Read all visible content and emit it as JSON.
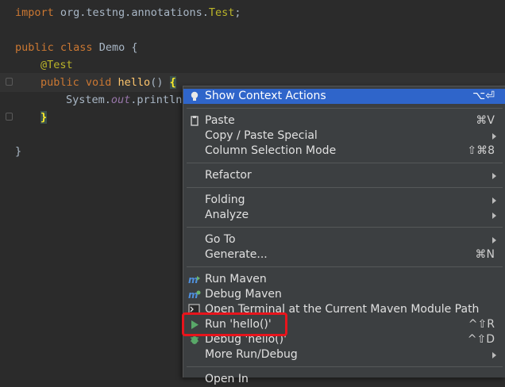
{
  "editor": {
    "lines": {
      "l1": {
        "kw": "import",
        "pkg": " org.testng.annotations.",
        "ann": "Test",
        "end": ";"
      },
      "l3": {
        "kw1": "public",
        "kw2": " class",
        "name": " Demo {"
      },
      "l4": {
        "ann": "@Test"
      },
      "l5": {
        "kw1": "public",
        "kw2": " void",
        "fn": " hello",
        "params": "() ",
        "brace": "{"
      },
      "l6": {
        "pre": "System.",
        "field": "out",
        "post": ".println("
      },
      "l7": {
        "brace": "}"
      },
      "l9": {
        "brace": "}"
      }
    }
  },
  "menu": {
    "show_context_actions": {
      "label": "Show Context Actions",
      "shortcut": "⌥⏎",
      "icon": "bulb-icon"
    },
    "paste": {
      "label": "Paste",
      "shortcut": "⌘V",
      "icon": "clipboard-icon"
    },
    "copy_paste_special": {
      "label": "Copy / Paste Special"
    },
    "column_selection_mode": {
      "label": "Column Selection Mode",
      "shortcut": "⇧⌘8"
    },
    "refactor": {
      "label": "Refactor"
    },
    "folding": {
      "label": "Folding"
    },
    "analyze": {
      "label": "Analyze"
    },
    "go_to": {
      "label": "Go To"
    },
    "generate": {
      "label": "Generate...",
      "shortcut": "⌘N"
    },
    "run_maven": {
      "label": "Run Maven",
      "icon": "maven-icon"
    },
    "debug_maven": {
      "label": "Debug Maven",
      "icon": "maven-debug-icon"
    },
    "open_terminal": {
      "label": "Open Terminal at the Current Maven Module Path",
      "icon": "terminal-icon"
    },
    "run_hello": {
      "label": "Run 'hello()'",
      "shortcut": "^⇧R",
      "icon": "run-icon"
    },
    "debug_hello": {
      "label": "Debug 'hello()'",
      "shortcut": "^⇧D",
      "icon": "debug-icon"
    },
    "more_run_debug": {
      "label": "More Run/Debug"
    },
    "open_in": {
      "label": "Open In"
    }
  },
  "colors": {
    "selection": "#2f65ca",
    "highlight_box": "#e8141c",
    "menu_bg": "#3c3f41",
    "editor_bg": "#2b2b2b"
  }
}
